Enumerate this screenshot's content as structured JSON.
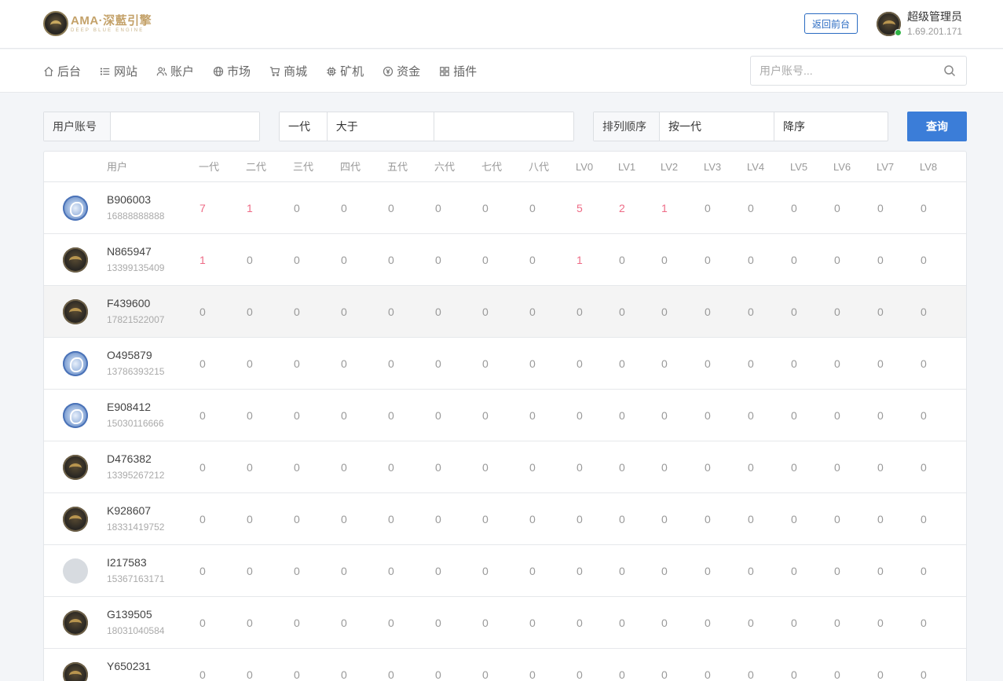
{
  "header": {
    "logo_main": "AMA·深藍引擎",
    "logo_sub": "DEEP BLUE ENGINE",
    "front_button": "返回前台",
    "user_name": "超级管理员",
    "user_ip": "1.69.201.171"
  },
  "nav": {
    "items": [
      {
        "label": "后台",
        "icon": "home-icon"
      },
      {
        "label": "网站",
        "icon": "list-icon"
      },
      {
        "label": "账户",
        "icon": "users-icon"
      },
      {
        "label": "市场",
        "icon": "globe-icon"
      },
      {
        "label": "商城",
        "icon": "cart-icon"
      },
      {
        "label": "矿机",
        "icon": "chip-icon"
      },
      {
        "label": "资金",
        "icon": "coin-icon"
      },
      {
        "label": "插件",
        "icon": "grid-icon"
      }
    ],
    "search_placeholder": "用户账号..."
  },
  "filters": {
    "account_label": "用户账号",
    "account_value": "",
    "generation": "一代",
    "comparator": "大于",
    "threshold_value": "",
    "sort_label": "排列顺序",
    "sort_by": "按一代",
    "sort_dir": "降序",
    "query_button": "查询"
  },
  "table": {
    "columns": [
      "用户",
      "一代",
      "二代",
      "三代",
      "四代",
      "五代",
      "六代",
      "七代",
      "八代",
      "LV0",
      "LV1",
      "LV2",
      "LV3",
      "LV4",
      "LV5",
      "LV6",
      "LV7",
      "LV8"
    ],
    "rows": [
      {
        "avatar": "dragon",
        "name": "B906003",
        "phone": "16888888888",
        "values": [
          7,
          1,
          0,
          0,
          0,
          0,
          0,
          0,
          5,
          2,
          1,
          0,
          0,
          0,
          0,
          0,
          0
        ]
      },
      {
        "avatar": "gold",
        "name": "N865947",
        "phone": "13399135409",
        "values": [
          1,
          0,
          0,
          0,
          0,
          0,
          0,
          0,
          1,
          0,
          0,
          0,
          0,
          0,
          0,
          0,
          0
        ]
      },
      {
        "avatar": "gold",
        "name": "F439600",
        "phone": "17821522007",
        "values": [
          0,
          0,
          0,
          0,
          0,
          0,
          0,
          0,
          0,
          0,
          0,
          0,
          0,
          0,
          0,
          0,
          0
        ],
        "highlighted": true
      },
      {
        "avatar": "dragon",
        "name": "O495879",
        "phone": "13786393215",
        "values": [
          0,
          0,
          0,
          0,
          0,
          0,
          0,
          0,
          0,
          0,
          0,
          0,
          0,
          0,
          0,
          0,
          0
        ]
      },
      {
        "avatar": "dragon",
        "name": "E908412",
        "phone": "15030116666",
        "values": [
          0,
          0,
          0,
          0,
          0,
          0,
          0,
          0,
          0,
          0,
          0,
          0,
          0,
          0,
          0,
          0,
          0
        ]
      },
      {
        "avatar": "gold",
        "name": "D476382",
        "phone": "13395267212",
        "values": [
          0,
          0,
          0,
          0,
          0,
          0,
          0,
          0,
          0,
          0,
          0,
          0,
          0,
          0,
          0,
          0,
          0
        ]
      },
      {
        "avatar": "gold",
        "name": "K928607",
        "phone": "18331419752",
        "values": [
          0,
          0,
          0,
          0,
          0,
          0,
          0,
          0,
          0,
          0,
          0,
          0,
          0,
          0,
          0,
          0,
          0
        ]
      },
      {
        "avatar": "blank",
        "name": "I217583",
        "phone": "15367163171",
        "values": [
          0,
          0,
          0,
          0,
          0,
          0,
          0,
          0,
          0,
          0,
          0,
          0,
          0,
          0,
          0,
          0,
          0
        ]
      },
      {
        "avatar": "gold",
        "name": "G139505",
        "phone": "18031040584",
        "values": [
          0,
          0,
          0,
          0,
          0,
          0,
          0,
          0,
          0,
          0,
          0,
          0,
          0,
          0,
          0,
          0,
          0
        ]
      },
      {
        "avatar": "gold",
        "name": "Y650231",
        "phone": "",
        "values": [
          0,
          0,
          0,
          0,
          0,
          0,
          0,
          0,
          0,
          0,
          0,
          0,
          0,
          0,
          0,
          0,
          0
        ]
      }
    ]
  },
  "colors": {
    "accent": "#3b7dd8",
    "nonzero": "#ee6b86",
    "online": "#2fb344"
  }
}
